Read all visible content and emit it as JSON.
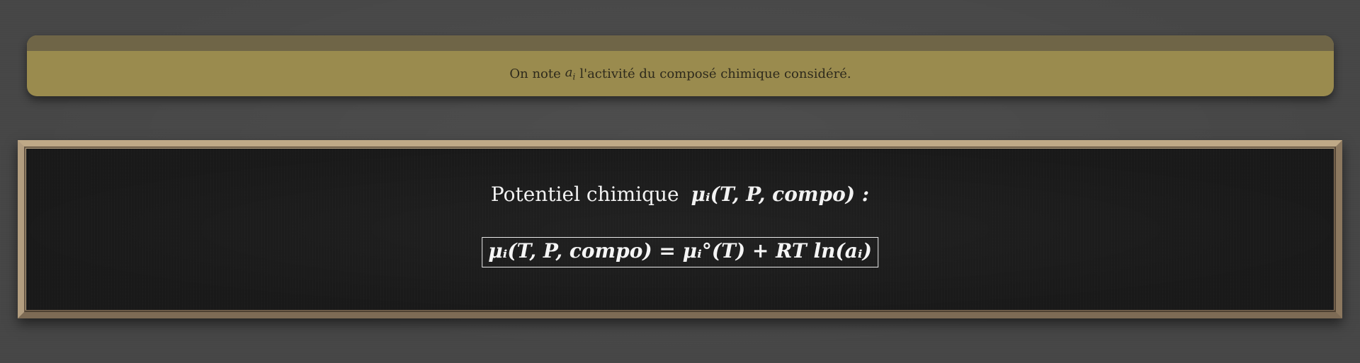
{
  "note_banner": {
    "prefix": "On note",
    "variable": "a",
    "variable_sub": "i",
    "suffix": "l'activité du composé chimique considéré."
  },
  "board": {
    "title_text": "Potentiel chimique",
    "title_math": "μᵢ(T, P, compo) :",
    "formula": "μᵢ(T, P, compo) = μᵢ°(T) + RT ln(aᵢ)"
  },
  "colors": {
    "page_background": "#464646",
    "banner_top": "#6f6547",
    "banner_body": "#9a8b4e",
    "board_background": "#191919",
    "board_frame": "#a89479",
    "chalk_text": "#f2f2f2"
  }
}
